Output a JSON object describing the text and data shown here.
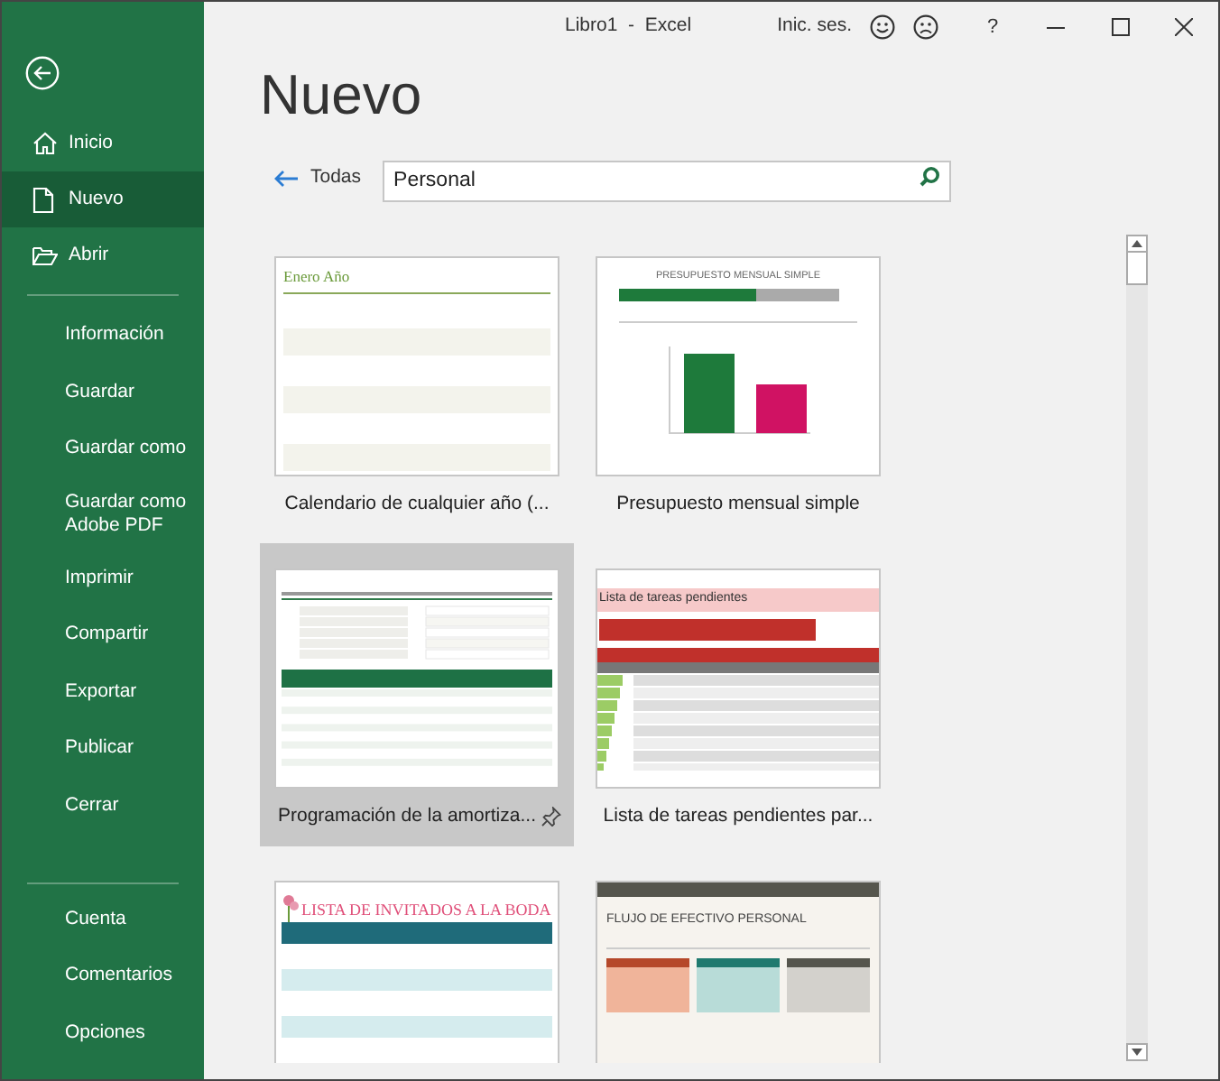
{
  "window": {
    "title": "Libro1  -  Excel",
    "sign_in": "Inic. ses.",
    "help": "?"
  },
  "sidebar": {
    "groups": [
      [
        {
          "label": "Inicio",
          "selected": false
        },
        {
          "label": "Nuevo",
          "selected": true
        },
        {
          "label": "Abrir",
          "selected": false
        }
      ],
      [
        {
          "label": "Información",
          "selected": false
        },
        {
          "label": "Guardar",
          "selected": false
        },
        {
          "label": "Guardar como",
          "selected": false
        },
        {
          "label": "Guardar como Adobe PDF",
          "selected": false
        },
        {
          "label": "Imprimir",
          "selected": false
        },
        {
          "label": "Compartir",
          "selected": false
        },
        {
          "label": "Exportar",
          "selected": false
        },
        {
          "label": "Publicar",
          "selected": false
        },
        {
          "label": "Cerrar",
          "selected": false
        }
      ],
      [
        {
          "label": "Cuenta",
          "selected": false
        },
        {
          "label": "Comentarios",
          "selected": false
        },
        {
          "label": "Opciones",
          "selected": false
        }
      ]
    ]
  },
  "page": {
    "heading": "Nuevo",
    "back_link": "Todas",
    "search": {
      "value": "Personal"
    }
  },
  "templates": [
    {
      "kind": "calendar",
      "preview_title": "Enero Año",
      "title": "Calendario de cualquier año (...",
      "selected": false,
      "pin_visible": false
    },
    {
      "kind": "budget",
      "preview_title": "PRESUPUESTO MENSUAL SIMPLE",
      "title": "Presupuesto mensual simple",
      "selected": false,
      "pin_visible": false
    },
    {
      "kind": "loan",
      "title": "Programación de la amortiza...",
      "selected": true,
      "pin_visible": true
    },
    {
      "kind": "todo",
      "preview_title": "Lista de tareas pendientes",
      "title": "Lista de tareas pendientes par...",
      "selected": false,
      "pin_visible": false
    },
    {
      "kind": "wedding",
      "preview_title": "LISTA DE INVITADOS A LA BODA",
      "selected": false,
      "pin_visible": false
    },
    {
      "kind": "cashflow",
      "preview_title": "FLUJO DE EFECTIVO PERSONAL",
      "selected": false,
      "pin_visible": false
    }
  ]
}
